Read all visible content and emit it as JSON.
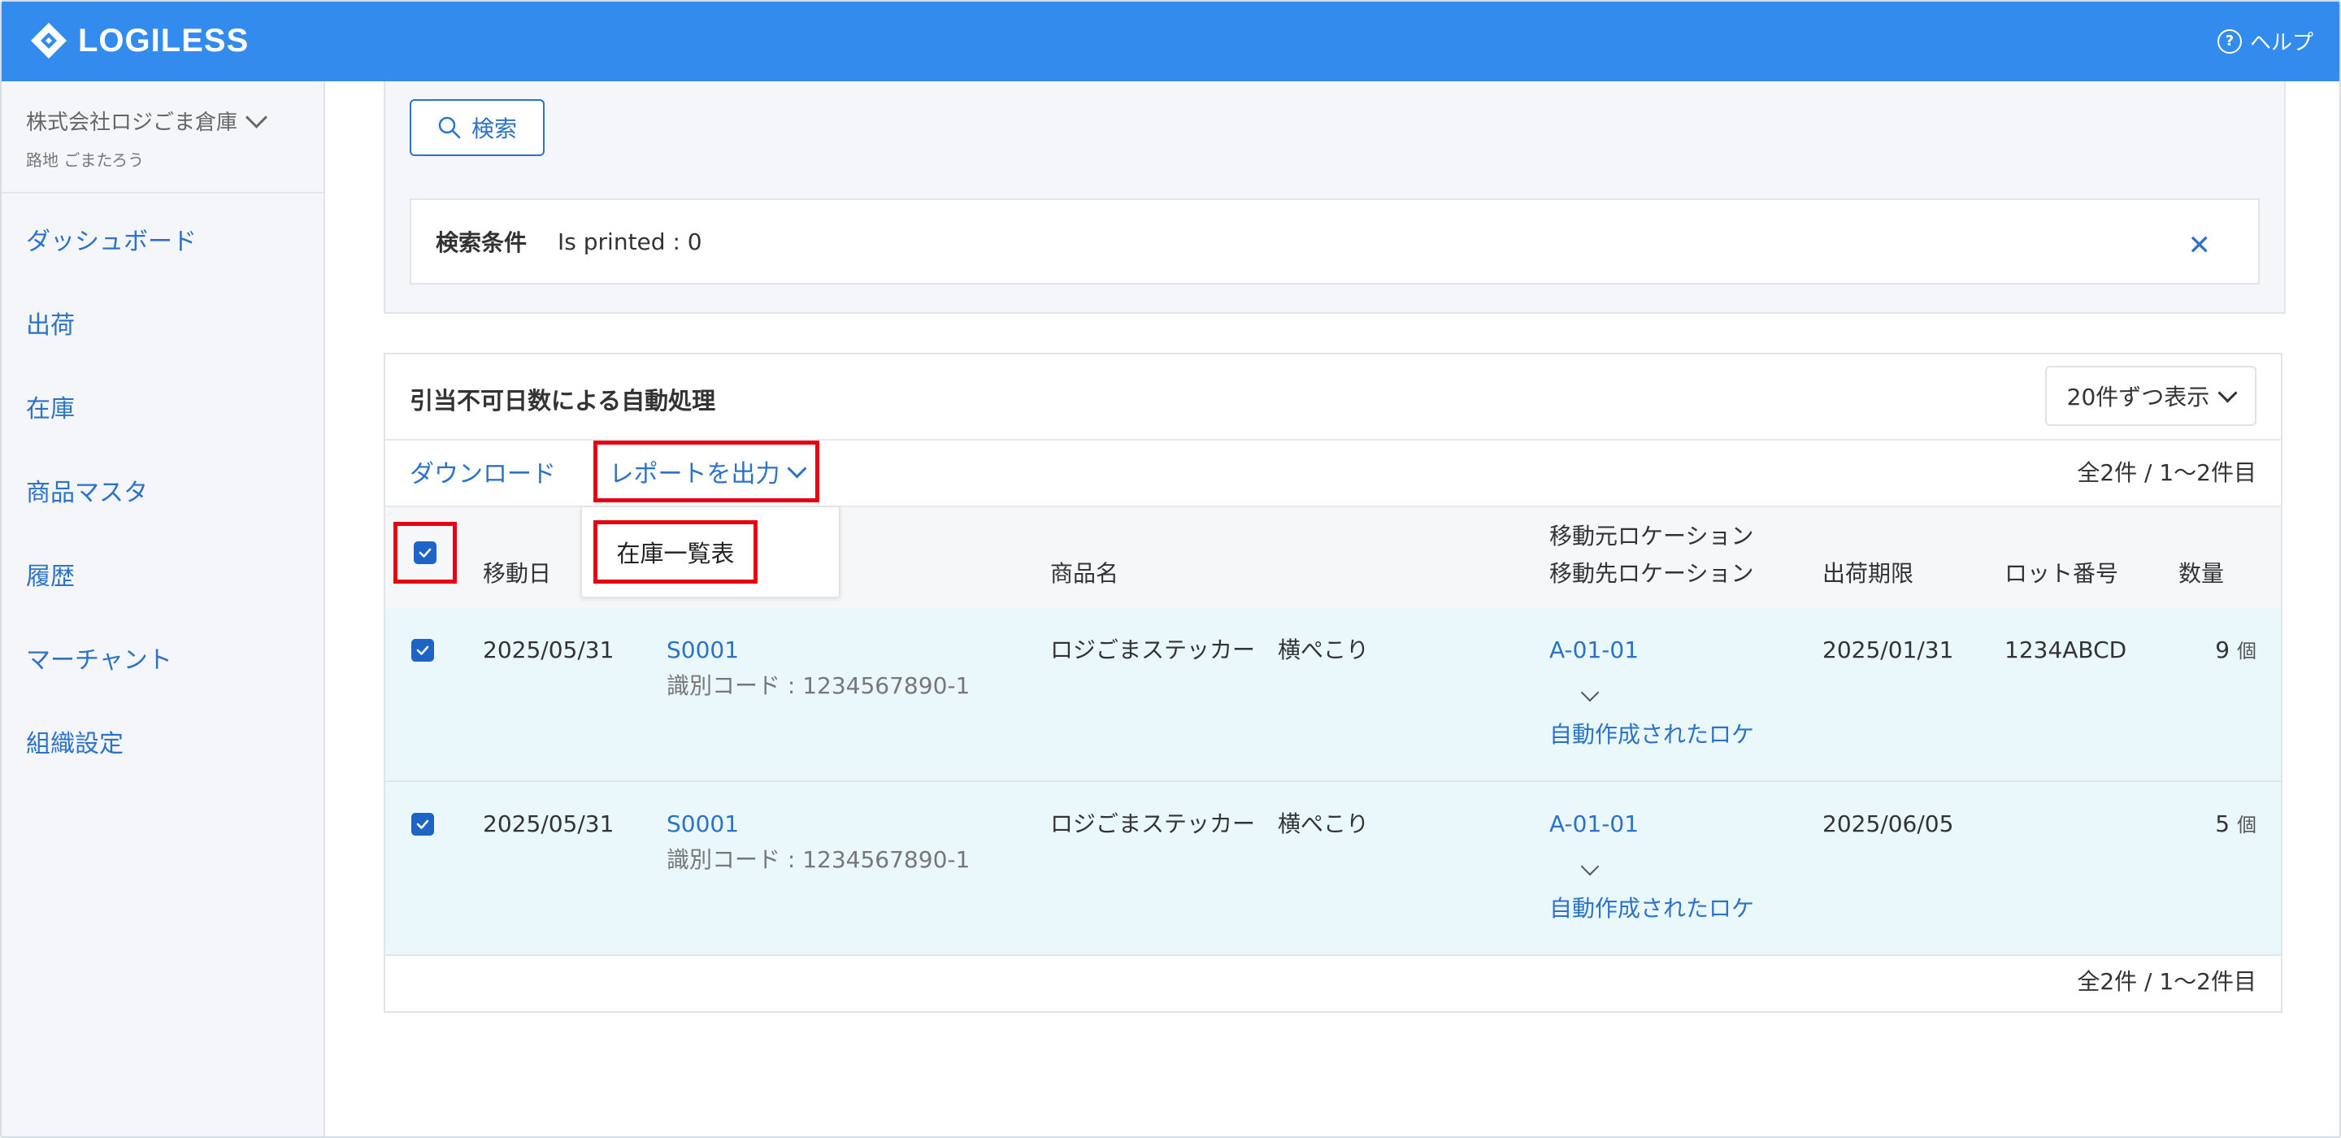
{
  "header": {
    "logo_text": "LOGILESS",
    "help_label": "ヘルプ",
    "help_icon": "question-circle-icon",
    "bar_color": "#338ced"
  },
  "sidebar": {
    "org_name": "株式会社ロジごま倉庫",
    "user_name": "路地 ごまたろう",
    "items": [
      {
        "label": "ダッシュボード"
      },
      {
        "label": "出荷"
      },
      {
        "label": "在庫"
      },
      {
        "label": "商品マスタ"
      },
      {
        "label": "履歴"
      },
      {
        "label": "マーチャント"
      },
      {
        "label": "組織設定"
      }
    ]
  },
  "search": {
    "button_label": "検索",
    "conditions_label": "検索条件",
    "conditions_value": "Is printed : 0"
  },
  "list": {
    "title": "引当不可日数による自動処理",
    "per_page": "20件ずつ表示",
    "download_label": "ダウンロード",
    "report_label": "レポートを出力",
    "report_menu_item": "在庫一覧表",
    "count_text": "全2件 / 1〜2件目",
    "columns": {
      "date": "移動日",
      "product": "商品名",
      "location_from": "移動元ロケーション",
      "location_to": "移動先ロケーション",
      "expiry": "出荷期限",
      "lot": "ロット番号",
      "qty": "数量"
    },
    "rows": [
      {
        "checked": true,
        "date": "2025/05/31",
        "code": "S0001",
        "id_code": "識別コード : 1234567890-1",
        "product": "ロジごまステッカー　横ぺこり",
        "loc_from": "A-01-01",
        "loc_to": "自動作成されたロケ",
        "expiry": "2025/01/31",
        "lot": "1234ABCD",
        "qty": "9",
        "unit": "個"
      },
      {
        "checked": true,
        "date": "2025/05/31",
        "code": "S0001",
        "id_code": "識別コード : 1234567890-1",
        "product": "ロジごまステッカー　横ぺこり",
        "loc_from": "A-01-01",
        "loc_to": "自動作成されたロケ",
        "expiry": "2025/06/05",
        "lot": "",
        "qty": "5",
        "unit": "個"
      }
    ]
  },
  "colors": {
    "accent": "#2b72c9",
    "highlight_border": "#e60012",
    "row_bg": "#eaf8fb"
  }
}
